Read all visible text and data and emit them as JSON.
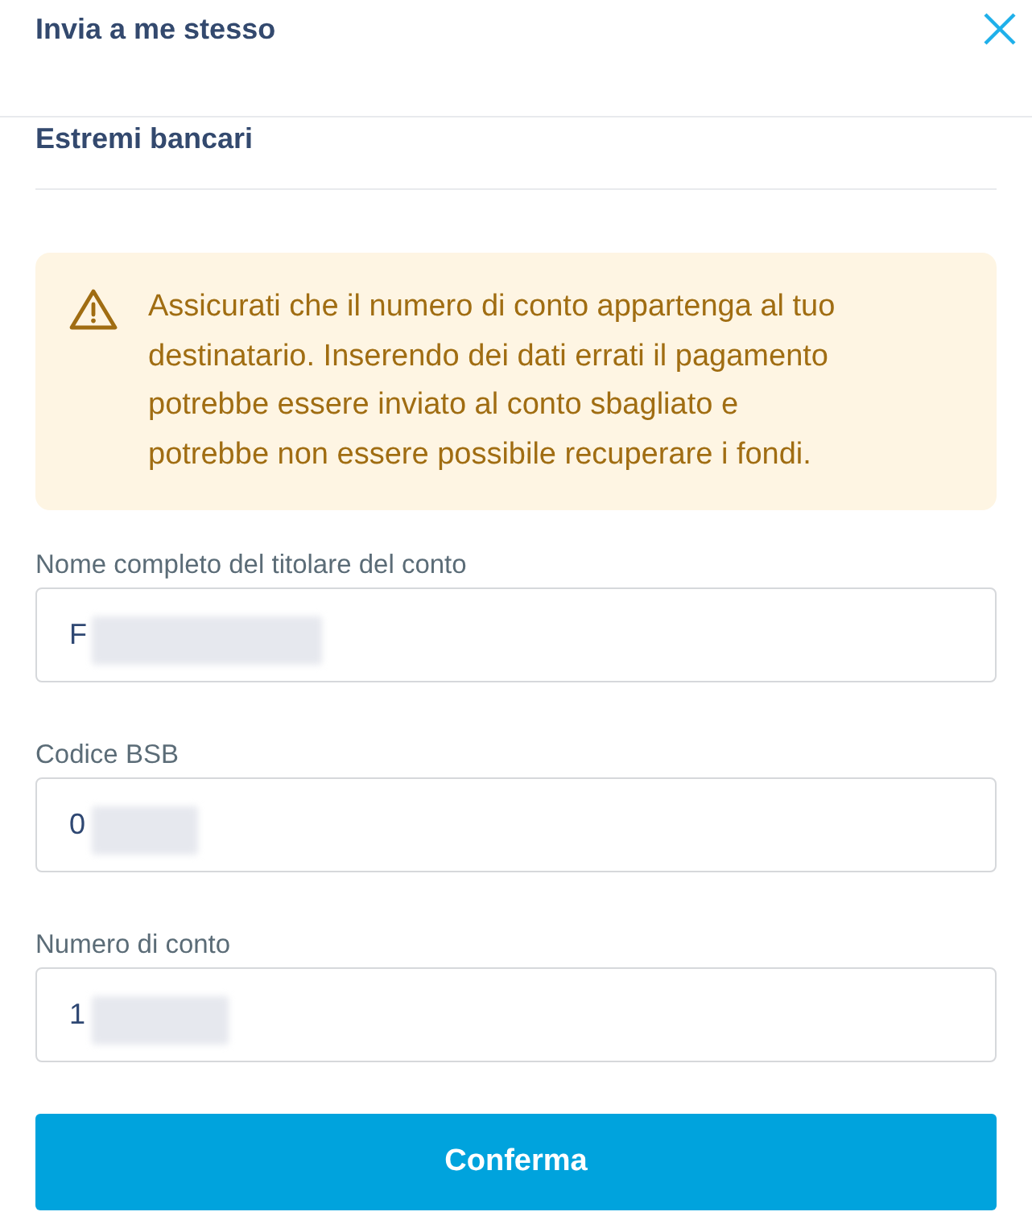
{
  "header": {
    "title": "Invia a me stesso"
  },
  "section": {
    "title": "Estremi bancari"
  },
  "warning": {
    "text": "Assicurati che il numero di conto appartenga al tuo destinatario. Inserendo dei dati errati il pagamento potrebbe essere inviato al conto sbagliato e potrebbe non essere possibile recuperare i fondi."
  },
  "fields": [
    {
      "label": "Nome completo del titolare del conto",
      "value": "F",
      "redacted": true
    },
    {
      "label": "Codice BSB",
      "value": "0",
      "redacted": true
    },
    {
      "label": "Numero di conto",
      "value": "1",
      "redacted": true
    }
  ],
  "confirm_button": {
    "label": "Conferma"
  }
}
